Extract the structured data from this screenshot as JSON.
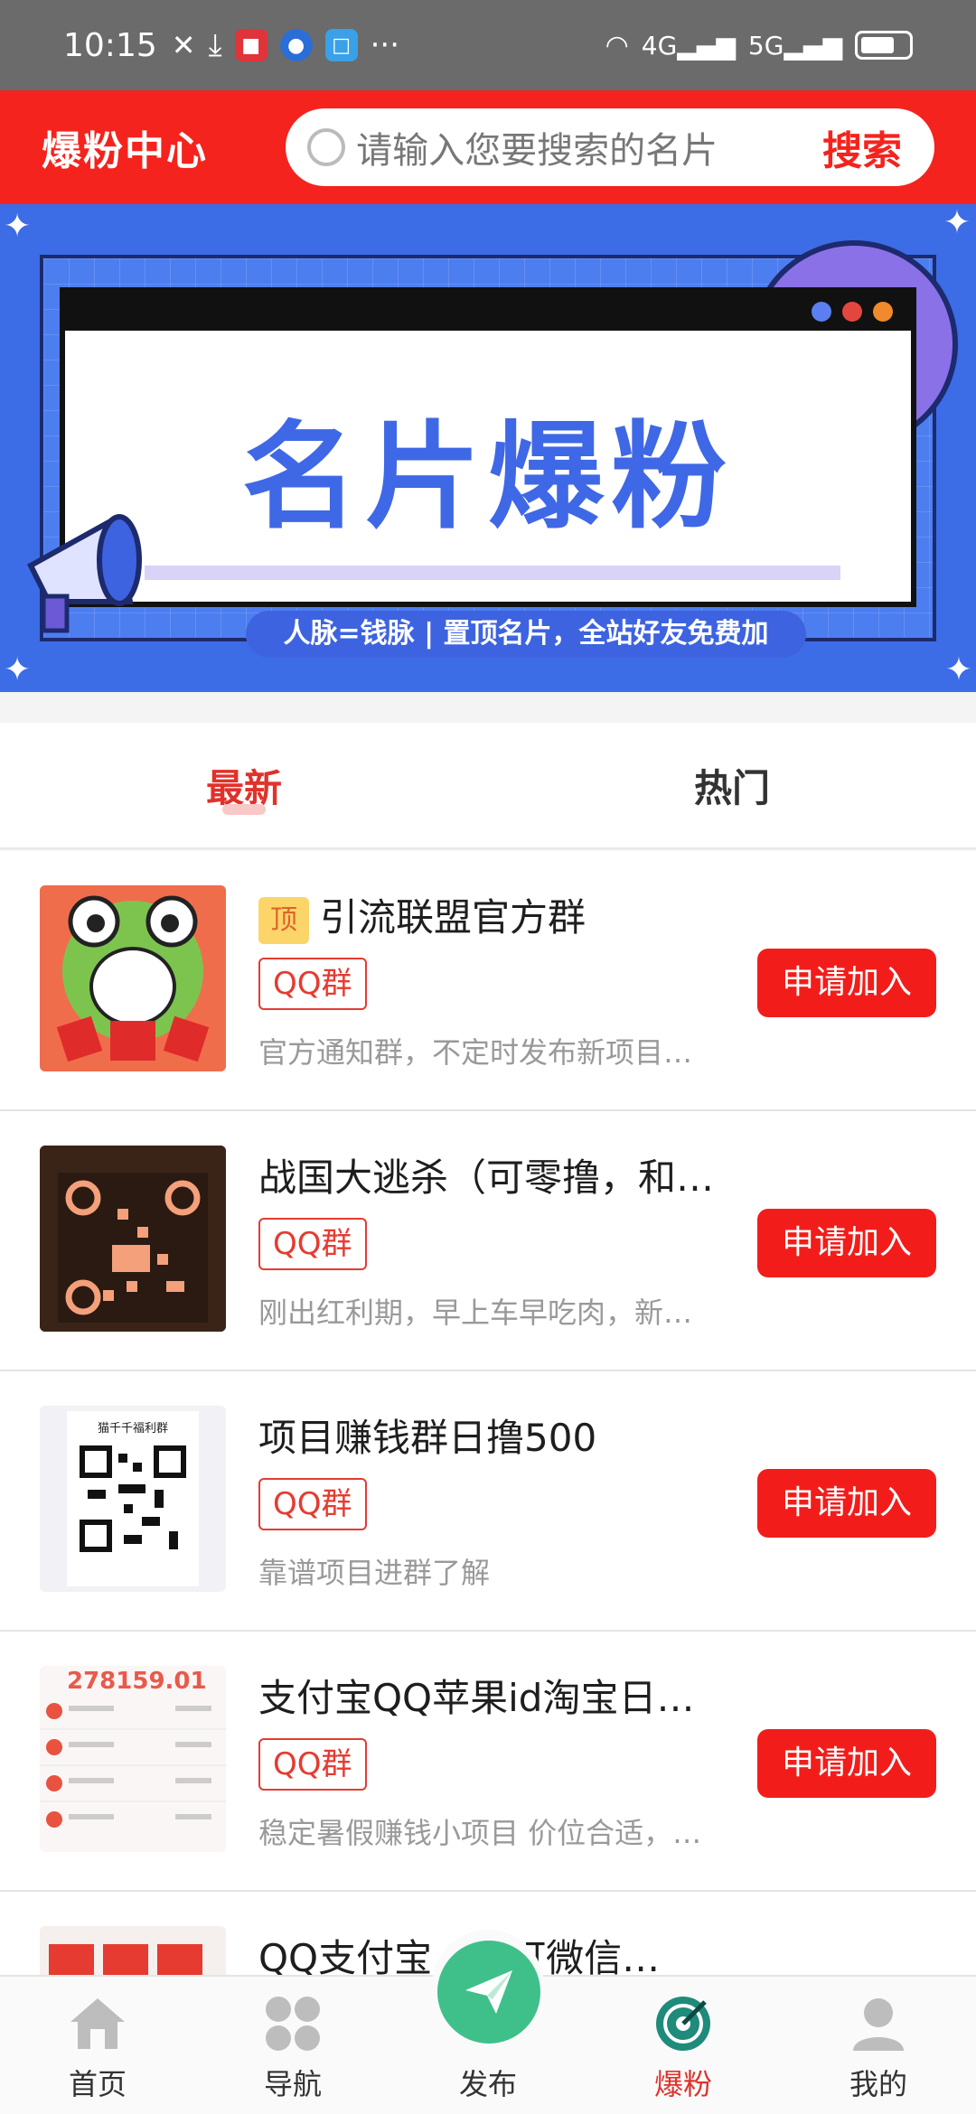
{
  "status_bar": {
    "time": "10:15",
    "more": "···",
    "net1": "4G",
    "net2": "5G"
  },
  "header": {
    "title": "爆粉中心",
    "search_placeholder": "请输入您要搜索的名片",
    "search_button": "搜索"
  },
  "banner": {
    "headline": "名片爆粉",
    "slogan": "人脉=钱脉 | 置顶名片，全站好友免费加"
  },
  "tabs": [
    {
      "label": "最新",
      "active": true
    },
    {
      "label": "热门",
      "active": false
    }
  ],
  "items": [
    {
      "pinned": true,
      "pin_label": "顶",
      "title": "引流联盟官方群",
      "tag": "QQ群",
      "desc": "官方通知群，不定时发布新项目…",
      "button": "申请加入"
    },
    {
      "pinned": false,
      "title": "战国大逃杀（可零撸，和…",
      "tag": "QQ群",
      "desc": "刚出红利期，早上车早吃肉，新…",
      "button": "申请加入"
    },
    {
      "pinned": false,
      "title": "项目赚钱群日撸500",
      "tag": "QQ群",
      "desc": "靠谱项目进群了解",
      "button": "申请加入",
      "thumb_label": "猫千千福利群"
    },
    {
      "pinned": false,
      "title": "支付宝QQ苹果id淘宝日…",
      "tag": "QQ群",
      "desc": "稳定暑假赚钱小项目 价位合适，…",
      "button": "申请加入",
      "thumb_amount": "278159.01"
    },
    {
      "pinned": false,
      "title": "QQ支付宝…钉钉微信…",
      "tag": "",
      "desc": "",
      "button": ""
    }
  ],
  "bottom_nav": [
    {
      "label": "首页",
      "icon": "home-icon",
      "active": false
    },
    {
      "label": "导航",
      "icon": "grid-icon",
      "active": false
    },
    {
      "label": "发布",
      "icon": "paper-plane-icon",
      "active": false
    },
    {
      "label": "爆粉",
      "icon": "target-icon",
      "active": true
    },
    {
      "label": "我的",
      "icon": "user-icon",
      "active": false
    }
  ],
  "colors": {
    "brand_red": "#f5231d",
    "banner_blue": "#3c6ce6",
    "publish_green": "#3fc08b"
  }
}
